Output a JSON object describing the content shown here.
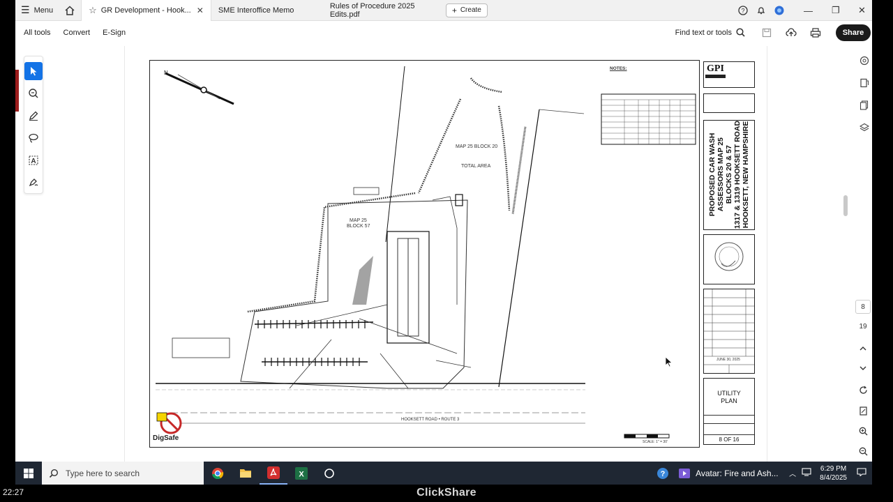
{
  "tabbar": {
    "menu_label": "Menu",
    "tabs": [
      {
        "label": "GR Development - Hook...",
        "active": true
      },
      {
        "label": "SME Interoffice Memo",
        "active": false
      },
      {
        "label": "Rules of Procedure 2025 Edits.pdf",
        "active": false
      }
    ],
    "create_label": "Create"
  },
  "toolbar": {
    "all_tools": "All tools",
    "convert": "Convert",
    "esign": "E-Sign",
    "find": "Find text or tools",
    "share": "Share"
  },
  "pages": {
    "current": "8",
    "total": "19"
  },
  "drawing": {
    "map_block_20": "MAP 25 BLOCK 20",
    "total_area": "TOTAL AREA",
    "map25": "MAP 25",
    "block57": "BLOCK 57",
    "notes": "NOTES:",
    "road": "HOOKSETT ROAD • ROUTE 3",
    "digsafe": "DigSafe",
    "scale": "SCALE: 1\" = 30'"
  },
  "titleblock": {
    "company": "GPI",
    "project_line1": "PROPOSED CAR WASH",
    "project_line2": "ASSESSORS MAP 25",
    "project_line3": "BLOCKS 20 & 57",
    "project_line4": "1317 & 1319 HOOKSETT ROAD",
    "project_line5": "HOOKSETT, NEW HAMPSHIRE",
    "date": "JUNE 30, 2025",
    "sheet_title_1": "UTILITY",
    "sheet_title_2": "PLAN",
    "sheet_number": "8 OF 16"
  },
  "taskbar": {
    "search_placeholder": "Type here to search",
    "media": "Avatar: Fire and Ash...",
    "time": "6:29 PM",
    "date": "8/4/2025"
  },
  "overlay": {
    "left_clock": "22:27",
    "brand": "ClickShare"
  }
}
